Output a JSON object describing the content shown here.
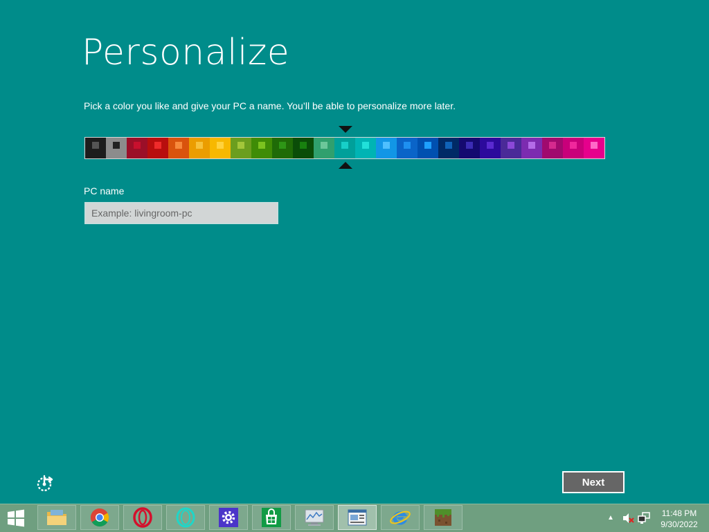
{
  "page": {
    "title": "Personalize",
    "subtitle": "Pick a color you like and give your PC a name. You’ll be able to personalize more later.",
    "pc_name_label": "PC name",
    "pc_name_placeholder": "Example: livingroom-pc",
    "pc_name_value": "",
    "next_label": "Next",
    "ease_icon": "ease-of-access-icon"
  },
  "palette": {
    "selected_index": 12,
    "swatches": [
      {
        "base": "#1d1d1d",
        "accent": "#555555"
      },
      {
        "base": "#8c8c8c",
        "accent": "#222222"
      },
      {
        "base": "#9b0f28",
        "accent": "#c8102e"
      },
      {
        "base": "#b80e0e",
        "accent": "#ef2b2b"
      },
      {
        "base": "#d9530d",
        "accent": "#f7893c"
      },
      {
        "base": "#eb9d00",
        "accent": "#f7c23b"
      },
      {
        "base": "#f7b800",
        "accent": "#ffd23d"
      },
      {
        "base": "#6b9e1e",
        "accent": "#a3c63a"
      },
      {
        "base": "#3f8c06",
        "accent": "#7cc21f"
      },
      {
        "base": "#1f6b07",
        "accent": "#2e9616"
      },
      {
        "base": "#0a4d08",
        "accent": "#18800f"
      },
      {
        "base": "#30a06e",
        "accent": "#6cc79a"
      },
      {
        "base": "#00a09a",
        "accent": "#17cfc8"
      },
      {
        "base": "#00b4b4",
        "accent": "#21e0d9"
      },
      {
        "base": "#1296e6",
        "accent": "#4fc0ff"
      },
      {
        "base": "#0a64c8",
        "accent": "#1e90f0"
      },
      {
        "base": "#0050b0",
        "accent": "#1ea0ff"
      },
      {
        "base": "#002a66",
        "accent": "#1062b8"
      },
      {
        "base": "#140a70",
        "accent": "#3b2cb5"
      },
      {
        "base": "#2c0a9c",
        "accent": "#5a2ad0"
      },
      {
        "base": "#4a2a98",
        "accent": "#8c48d8"
      },
      {
        "base": "#7c2cb0",
        "accent": "#b46ce8"
      },
      {
        "base": "#a00a6e",
        "accent": "#d52a8e"
      },
      {
        "base": "#c8007a",
        "accent": "#f0289c"
      },
      {
        "base": "#e6008c",
        "accent": "#ff6ac8"
      }
    ]
  },
  "taskbar": {
    "start_icon": "windows-logo-icon",
    "apps": [
      {
        "name": "file-explorer",
        "icon": "folder-icon",
        "active": false
      },
      {
        "name": "chrome",
        "icon": "chrome-icon",
        "active": false
      },
      {
        "name": "opera",
        "icon": "opera-icon",
        "active": false
      },
      {
        "name": "opera-gx",
        "icon": "opera-gx-icon",
        "active": false
      },
      {
        "name": "settings",
        "icon": "gear-icon",
        "active": false
      },
      {
        "name": "store",
        "icon": "store-icon",
        "active": false
      },
      {
        "name": "system-monitor",
        "icon": "monitor-chart-icon",
        "active": false
      },
      {
        "name": "setup-window",
        "icon": "window-icon",
        "active": true
      },
      {
        "name": "internet-explorer",
        "icon": "ie-icon",
        "active": false
      },
      {
        "name": "minecraft",
        "icon": "grass-block-icon",
        "active": false
      }
    ],
    "clock_time": "11:48 PM",
    "clock_date": "9/30/2022"
  }
}
